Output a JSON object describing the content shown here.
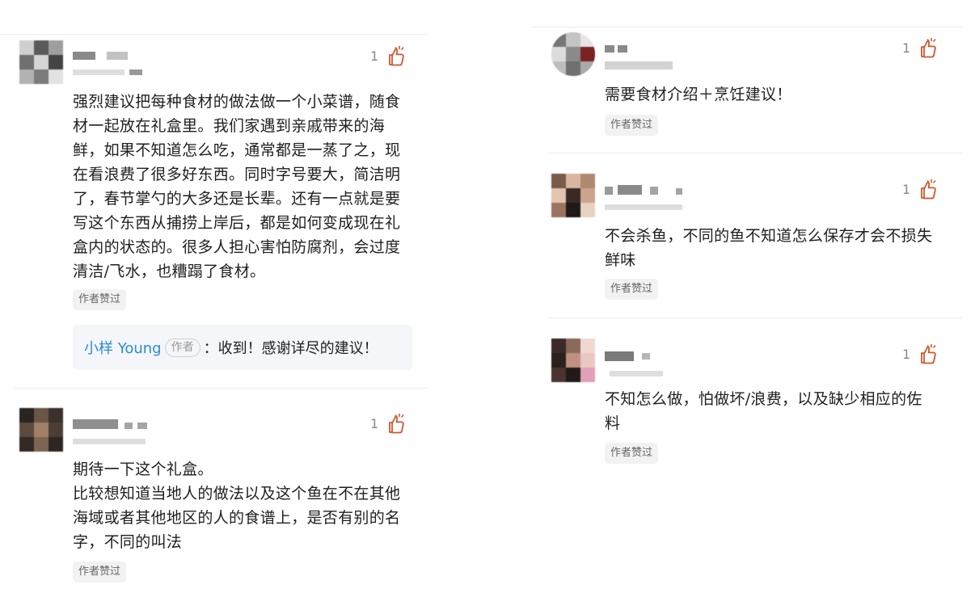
{
  "colors": {
    "like_icon": "#d2552f",
    "reply_name": "#2b8bd8",
    "badge_bg": "#f2f2f2"
  },
  "icons": {
    "like": "thumbs-up-icon"
  },
  "left_column": {
    "comments": [
      {
        "likes": "1",
        "text": "强烈建议把每种食材的做法做一个小菜谱，随食\n材一起放在礼盒里。我们家遇到亲戚带来的海\n鲜，如果不知道怎么吃，通常都是一蒸了之，现\n在看浪费了很多好东西。同时字号要大，简洁明\n了，春节掌勺的大多还是长辈。还有一点就是要\n写这个东西从捕捞上岸后，都是如何变成现在礼\n盒内的状态的。很多人担心害怕防腐剂，会过度\n清洁/飞水，也糟蹋了食材。",
        "badge": "作者赞过",
        "reply": {
          "name": "小样 Young",
          "author_tag": "作者",
          "text": "：收到！感谢详尽的建议！"
        }
      },
      {
        "likes": "1",
        "text": "期待一下这个礼盒。\n比较想知道当地人的做法以及这个鱼在不在其他\n海域或者其他地区的人的食谱上，是否有别的名\n字，不同的叫法",
        "badge": "作者赞过"
      }
    ]
  },
  "right_column": {
    "comments": [
      {
        "likes": "1",
        "text": "需要食材介绍＋烹饪建议！",
        "badge": "作者赞过"
      },
      {
        "likes": "1",
        "text": "不会杀鱼，不同的鱼不知道怎么保存才会不损失\n鲜味",
        "badge": "作者赞过"
      },
      {
        "likes": "1",
        "text": "不知怎么做，怕做坏/浪费，以及缺少相应的佐\n料",
        "badge": "作者赞过"
      }
    ]
  }
}
